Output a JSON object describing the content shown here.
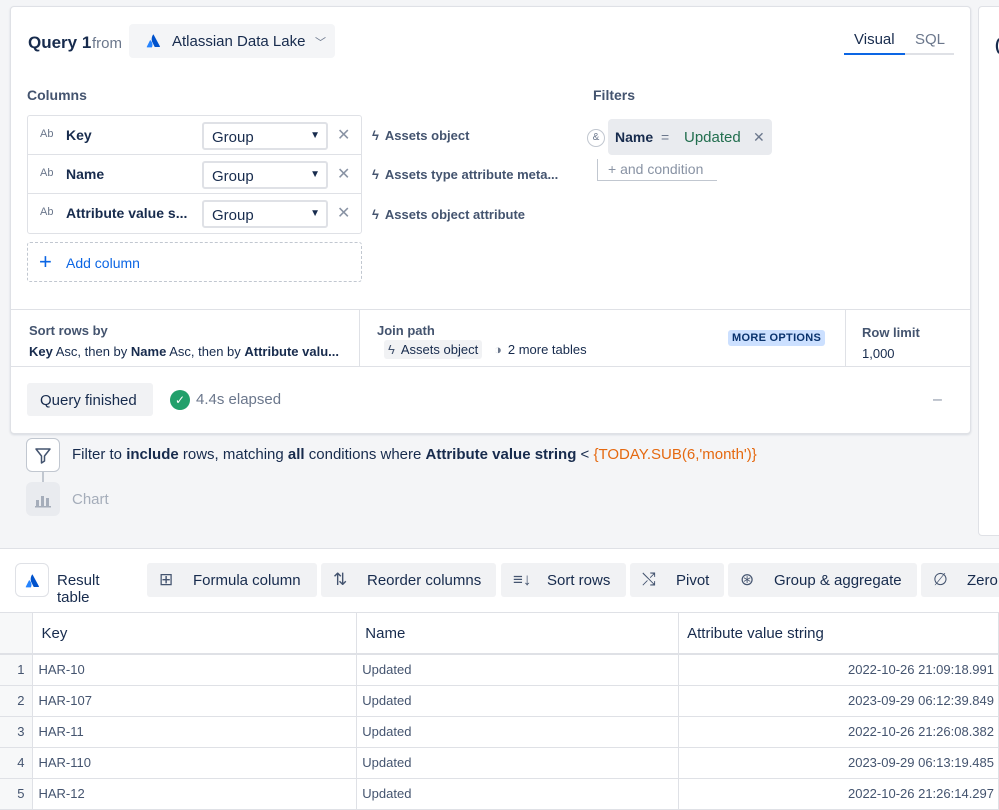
{
  "query": {
    "title": "Query 1",
    "from_label": "from",
    "source": "Atlassian Data Lake",
    "tabs": [
      {
        "label": "Visual"
      },
      {
        "label": "SQL"
      }
    ]
  },
  "columns": {
    "label": "Columns",
    "items": [
      {
        "type": "Ab",
        "name": "Key",
        "agg": "Group",
        "source": "Assets object"
      },
      {
        "type": "Ab",
        "name": "Name",
        "agg": "Group",
        "source": "Assets type attribute meta..."
      },
      {
        "type": "Ab",
        "name": "Attribute value s...",
        "agg": "Group",
        "source": "Assets object attribute"
      }
    ],
    "add_label": "Add column"
  },
  "filters": {
    "label": "Filters",
    "conjunction": "&",
    "chip": {
      "field": "Name",
      "op": "=",
      "value": "Updated"
    },
    "and_condition": "+ and condition"
  },
  "sort": {
    "label": "Sort rows by",
    "parts": [
      "Key",
      " Asc, then by ",
      "Name",
      " Asc, then by ",
      "Attribute valu..."
    ]
  },
  "join": {
    "label": "Join path",
    "table": "Assets object",
    "more": "2 more tables",
    "more_options": "MORE OPTIONS"
  },
  "row_limit": {
    "label": "Row limit",
    "value": "1,000"
  },
  "status": {
    "button": "Query finished",
    "elapsed": "4.4s elapsed",
    "collapse": "–"
  },
  "steps": {
    "filter": {
      "p1": "Filter to ",
      "include": "include",
      "p2": " rows, matching ",
      "all": "all",
      "p3": " conditions where ",
      "field": "Attribute value string",
      "op": " < ",
      "expr": "{TODAY.SUB(6,'month')}"
    },
    "chart": "Chart"
  },
  "toolbar": {
    "result_table": "Result table",
    "formula": "Formula column",
    "reorder": "Reorder columns",
    "sort": "Sort rows",
    "pivot": "Pivot",
    "group": "Group & aggregate",
    "zero": "Zero"
  },
  "table": {
    "headers": [
      "Key",
      "Name",
      "Attribute value string"
    ],
    "rows": [
      {
        "n": "1",
        "key": "HAR-10",
        "name": "Updated",
        "attr": "2022-10-26 21:09:18.991"
      },
      {
        "n": "2",
        "key": "HAR-107",
        "name": "Updated",
        "attr": "2023-09-29 06:12:39.849"
      },
      {
        "n": "3",
        "key": "HAR-11",
        "name": "Updated",
        "attr": "2022-10-26 21:26:08.382"
      },
      {
        "n": "4",
        "key": "HAR-110",
        "name": "Updated",
        "attr": "2023-09-29 06:13:19.485"
      },
      {
        "n": "5",
        "key": "HAR-12",
        "name": "Updated",
        "attr": "2022-10-26 21:26:14.297"
      }
    ]
  },
  "colors": {
    "accent": "#0c66e4",
    "success": "#22a06b",
    "expr": "#e56910",
    "badge_bg": "#cce0ff"
  }
}
